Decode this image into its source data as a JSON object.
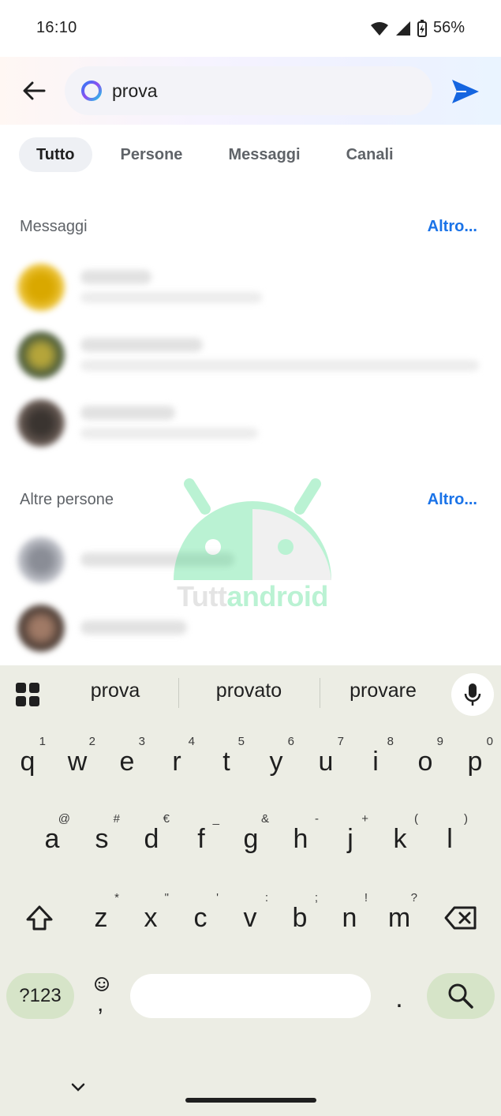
{
  "status_bar": {
    "time": "16:10",
    "battery": "56%"
  },
  "search": {
    "query": "prova"
  },
  "tabs": [
    {
      "label": "Tutto",
      "active": true
    },
    {
      "label": "Persone",
      "active": false
    },
    {
      "label": "Messaggi",
      "active": false
    },
    {
      "label": "Canali",
      "active": false
    }
  ],
  "sections": {
    "messages": {
      "title": "Messaggi",
      "more": "Altro..."
    },
    "people": {
      "title": "Altre persone",
      "more": "Altro..."
    }
  },
  "watermark": {
    "part1": "Tutt",
    "part2": "android"
  },
  "keyboard": {
    "suggestions": [
      "prova",
      "provato",
      "provare"
    ],
    "row1": [
      {
        "k": "q",
        "h": "1"
      },
      {
        "k": "w",
        "h": "2"
      },
      {
        "k": "e",
        "h": "3"
      },
      {
        "k": "r",
        "h": "4"
      },
      {
        "k": "t",
        "h": "5"
      },
      {
        "k": "y",
        "h": "6"
      },
      {
        "k": "u",
        "h": "7"
      },
      {
        "k": "i",
        "h": "8"
      },
      {
        "k": "o",
        "h": "9"
      },
      {
        "k": "p",
        "h": "0"
      }
    ],
    "row2": [
      {
        "k": "a",
        "h": "@"
      },
      {
        "k": "s",
        "h": "#"
      },
      {
        "k": "d",
        "h": "€"
      },
      {
        "k": "f",
        "h": "_"
      },
      {
        "k": "g",
        "h": "&"
      },
      {
        "k": "h",
        "h": "-"
      },
      {
        "k": "j",
        "h": "+"
      },
      {
        "k": "k",
        "h": "("
      },
      {
        "k": "l",
        "h": ")"
      }
    ],
    "row3": [
      {
        "k": "z",
        "h": "*"
      },
      {
        "k": "x",
        "h": "\""
      },
      {
        "k": "c",
        "h": "'"
      },
      {
        "k": "v",
        "h": ":"
      },
      {
        "k": "b",
        "h": ";"
      },
      {
        "k": "n",
        "h": "!"
      },
      {
        "k": "m",
        "h": "?"
      }
    ],
    "symbols_label": "?123",
    "comma_label": ",",
    "period_label": "."
  },
  "colors": {
    "accent": "#1a73e8",
    "send": "#1565e0",
    "keyboard_bg": "#ecede4",
    "action_key": "#d6e4c8"
  }
}
